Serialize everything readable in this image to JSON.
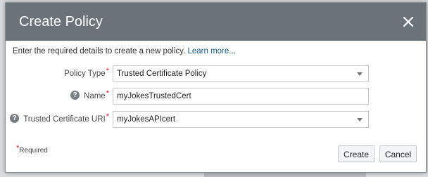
{
  "dialog": {
    "title": "Create Policy",
    "close_icon": "close-icon",
    "intro_text": "Enter the required details to create a new policy.",
    "learn_more": "Learn more..."
  },
  "form": {
    "required_marker": "*",
    "policy_type": {
      "label": "Policy Type",
      "value": "Trusted Certificate Policy"
    },
    "name": {
      "label": "Name",
      "value": "myJokesTrustedCert",
      "help_icon": "help-icon",
      "help_glyph": "?"
    },
    "trusted_cert_uri": {
      "label": "Trusted Certificate URI",
      "value": "myJokesAPIcert",
      "help_icon": "help-icon",
      "help_glyph": "?"
    },
    "required_note": "Required"
  },
  "buttons": {
    "create": "Create",
    "cancel": "Cancel"
  },
  "colors": {
    "header": "#6c7378",
    "link": "#0f5b9c",
    "required": "#c7161d"
  }
}
